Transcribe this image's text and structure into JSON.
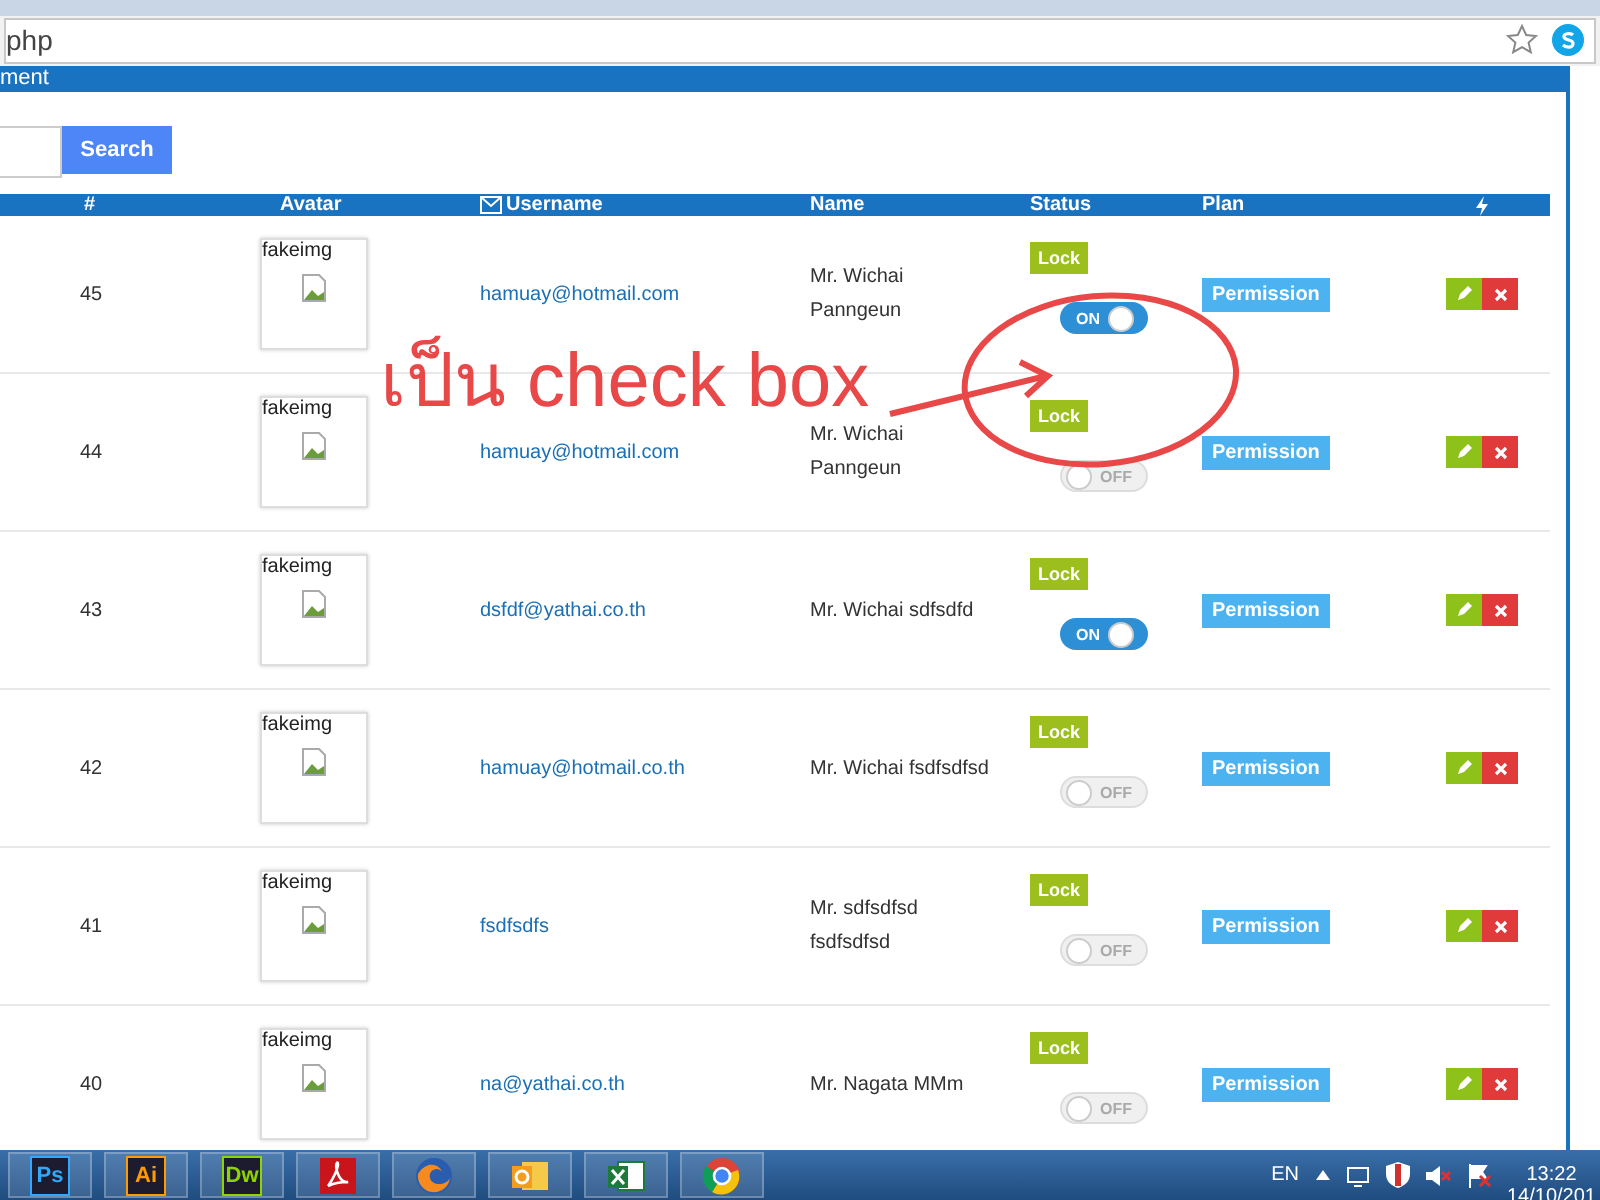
{
  "browser": {
    "address": "php"
  },
  "header": {
    "title": "ment"
  },
  "search": {
    "button": "Search"
  },
  "table": {
    "columns": [
      {
        "kind": "text",
        "label": "#"
      },
      {
        "kind": "text",
        "label": "Avatar"
      },
      {
        "kind": "mail",
        "label": "Username"
      },
      {
        "kind": "text",
        "label": "Name"
      },
      {
        "kind": "text",
        "label": "Status"
      },
      {
        "kind": "text",
        "label": "Plan"
      },
      {
        "kind": "bolt"
      }
    ],
    "rows": [
      {
        "id": "45",
        "avatar": "fakeimg",
        "username": "hamuay@hotmail.com",
        "name": "Mr. Wichai Panngeun",
        "lock": "Lock",
        "on": true,
        "toggle": "ON",
        "plan": "Permission"
      },
      {
        "id": "44",
        "avatar": "fakeimg",
        "username": "hamuay@hotmail.com",
        "name": "Mr. Wichai Panngeun",
        "lock": "Lock",
        "on": false,
        "toggle": "OFF",
        "plan": "Permission"
      },
      {
        "id": "43",
        "avatar": "fakeimg",
        "username": "dsfdf@yathai.co.th",
        "name": "Mr. Wichai sdfsdfd",
        "lock": "Lock",
        "on": true,
        "toggle": "ON",
        "plan": "Permission"
      },
      {
        "id": "42",
        "avatar": "fakeimg",
        "username": "hamuay@hotmail.co.th",
        "name": "Mr. Wichai fsdfsdfsd",
        "lock": "Lock",
        "on": false,
        "toggle": "OFF",
        "plan": "Permission"
      },
      {
        "id": "41",
        "avatar": "fakeimg",
        "username": "fsdfsdfs",
        "name": "Mr. sdfsdfsd fsdfsdfsd",
        "lock": "Lock",
        "on": false,
        "toggle": "OFF",
        "plan": "Permission"
      },
      {
        "id": "40",
        "avatar": "fakeimg",
        "username": "na@yathai.co.th",
        "name": "Mr. Nagata MMm",
        "lock": "Lock",
        "on": false,
        "toggle": "OFF",
        "plan": "Permission"
      }
    ]
  },
  "annotation": {
    "text": "เป็น check box"
  },
  "taskbar": {
    "apps": [
      {
        "kind": "letter",
        "label": "Ps",
        "color": "#31a8ff"
      },
      {
        "kind": "letter",
        "label": "Ai",
        "color": "#ff9a00"
      },
      {
        "kind": "letter",
        "label": "Dw",
        "color": "#8dd400"
      },
      {
        "kind": "pdf"
      },
      {
        "kind": "fox"
      },
      {
        "kind": "mail"
      },
      {
        "kind": "sheet"
      },
      {
        "kind": "wheel"
      }
    ],
    "language": "EN",
    "time": "13:22",
    "date": "14/10/201"
  }
}
